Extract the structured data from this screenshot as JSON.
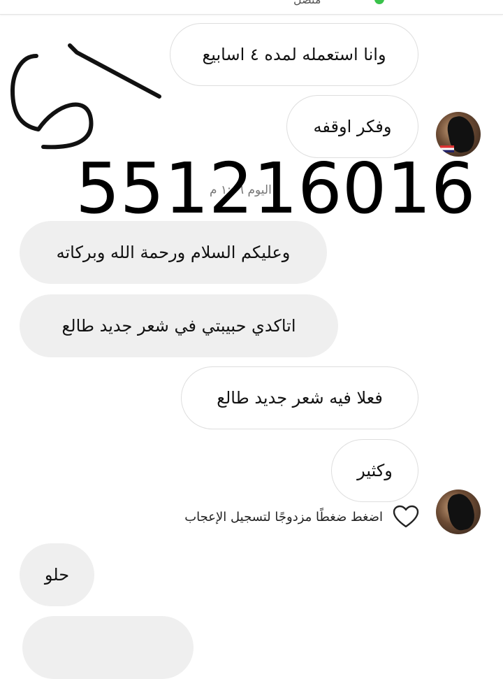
{
  "header": {
    "top_text": "متصل"
  },
  "overlay": {
    "handwriting": "51",
    "phone_number": "551216016"
  },
  "messages": {
    "m1": "وانا استعمله لمده ٤ اسابيع",
    "m2": "وفكر اوقفه",
    "timestamp": "اليوم ١:٠٦ م",
    "m3": "وعليكم السلام ورحمة الله وبركاته",
    "m4": "اتاكدي حبيبتي في شعر جديد طالع",
    "m5": "فعلا فيه شعر جديد طالع",
    "m6": "وكثير",
    "like_hint": "اضغط ضغطًا مزدوجًا لتسجيل الإعجاب",
    "m7": "حلو"
  },
  "icons": {
    "heart": "heart-outline-icon"
  },
  "colors": {
    "incoming_bubble": "#efefef",
    "outgoing_bubble": "#ffffff",
    "border": "#dedede",
    "online": "#39c24a"
  }
}
